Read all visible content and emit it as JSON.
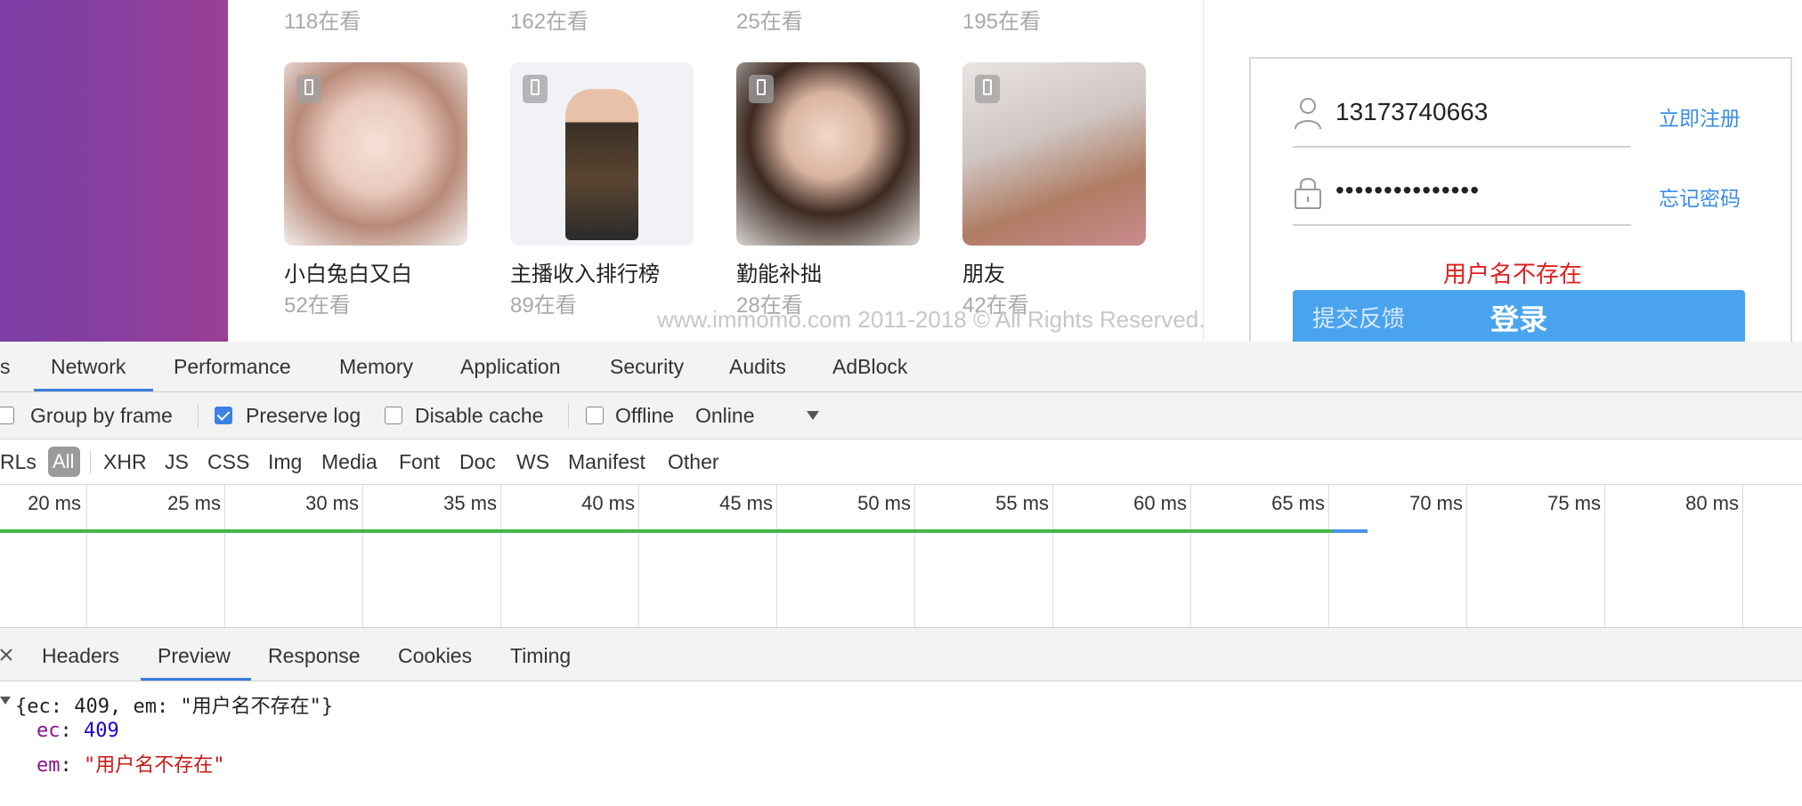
{
  "web": {
    "top_viewers": [
      "118在看",
      "162在看",
      "25在看",
      "195在看"
    ],
    "cards": [
      {
        "name": "小白兔白又白",
        "viewers": "52在看"
      },
      {
        "name": "主播收入排行榜",
        "viewers": "89在看"
      },
      {
        "name": "勤能补拙",
        "viewers": "28在看"
      },
      {
        "name": "朋友",
        "viewers": "42在看"
      }
    ],
    "copyright": "www.immomo.com 2011-2018 © All Rights Reserved.",
    "login": {
      "username": "13173740663",
      "password_mask": "•••••••••••••••",
      "register_link": "立即注册",
      "forgot_link": "忘记密码",
      "error": "用户名不存在",
      "feedback": "提交反馈",
      "login_button": "登录"
    }
  },
  "devtools": {
    "main_tabs": [
      "s",
      "Network",
      "Performance",
      "Memory",
      "Application",
      "Security",
      "Audits",
      "AdBlock"
    ],
    "active_tab": "Network",
    "toolbar": {
      "group_by_frame": "Group by frame",
      "preserve_log": "Preserve log",
      "preserve_log_checked": true,
      "disable_cache": "Disable cache",
      "offline": "Offline",
      "throttle": "Online"
    },
    "filters": {
      "urls_fragment": "RLs",
      "all": "All",
      "types": [
        "XHR",
        "JS",
        "CSS",
        "Img",
        "Media",
        "Font",
        "Doc",
        "WS",
        "Manifest",
        "Other"
      ]
    },
    "timeline_ticks": [
      "20 ms",
      "25 ms",
      "30 ms",
      "35 ms",
      "40 ms",
      "45 ms",
      "50 ms",
      "55 ms",
      "60 ms",
      "65 ms",
      "70 ms",
      "75 ms",
      "80 ms"
    ],
    "detail_tabs": [
      "Headers",
      "Preview",
      "Response",
      "Cookies",
      "Timing"
    ],
    "active_detail_tab": "Preview",
    "preview": {
      "summary": "{ec: 409, em: \"用户名不存在\"}",
      "ec_key": "ec",
      "ec_value": "409",
      "em_key": "em",
      "em_value": "\"用户名不存在\""
    },
    "colors": {
      "accent": "#3b7fd9",
      "green_bar": "#44b847",
      "blue_bar": "#4e92e8"
    }
  }
}
